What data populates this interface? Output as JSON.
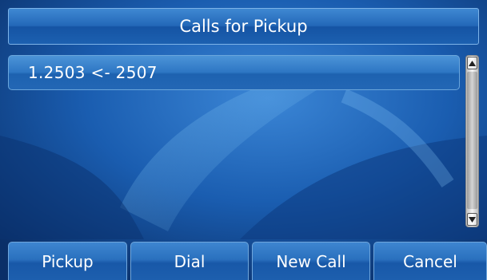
{
  "header": {
    "title": "Calls for Pickup"
  },
  "calls": [
    {
      "label": "1.2503 <- 2507"
    }
  ],
  "scrollbar": {
    "up_icon": "triangle-up-icon",
    "down_icon": "triangle-down-icon"
  },
  "softkeys": [
    {
      "label": "Pickup"
    },
    {
      "label": "Dial"
    },
    {
      "label": "New Call"
    },
    {
      "label": "Cancel"
    }
  ],
  "colors": {
    "accent": "#2a70be",
    "background": "#0c3a7a",
    "text": "#ffffff"
  }
}
